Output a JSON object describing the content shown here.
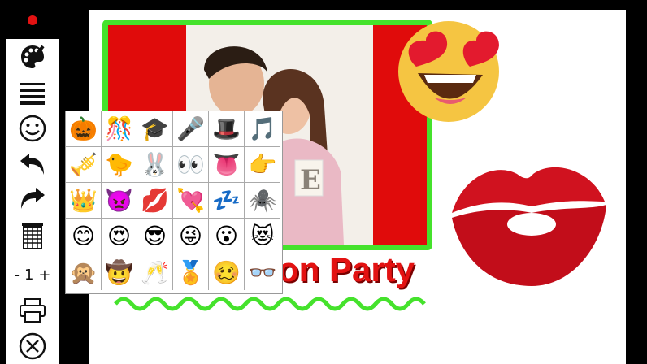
{
  "toolbar": {
    "record_indicator": "record-dot",
    "items": [
      {
        "name": "palette-icon"
      },
      {
        "name": "line-thickness-icon"
      },
      {
        "name": "smiley-icon"
      },
      {
        "name": "undo-icon"
      },
      {
        "name": "redo-icon"
      },
      {
        "name": "trash-icon"
      },
      {
        "name": "print-icon"
      },
      {
        "name": "close-icon"
      }
    ],
    "stepper": {
      "minus": "-",
      "value": "1",
      "plus": "+"
    }
  },
  "canvas": {
    "text": "on Party",
    "colors": {
      "frame": "#45e22c",
      "photo_bg": "#e00b0b",
      "text": "#e31212"
    }
  },
  "emoji_picker": {
    "rows": [
      [
        "🎃",
        "🎊",
        "🎓",
        "🎤",
        "🎩",
        "🎵"
      ],
      [
        "🎺",
        "🐤",
        "🐰",
        "👀",
        "👅",
        "👉"
      ],
      [
        "👑",
        "👿",
        "💋",
        "💘",
        "💤",
        "🕷️"
      ],
      [
        "😊",
        "😍",
        "😎",
        "😜",
        "😮",
        "😻"
      ],
      [
        "🙊",
        "🤠",
        "🥂",
        "🏅",
        "🥴",
        "👓"
      ]
    ]
  }
}
